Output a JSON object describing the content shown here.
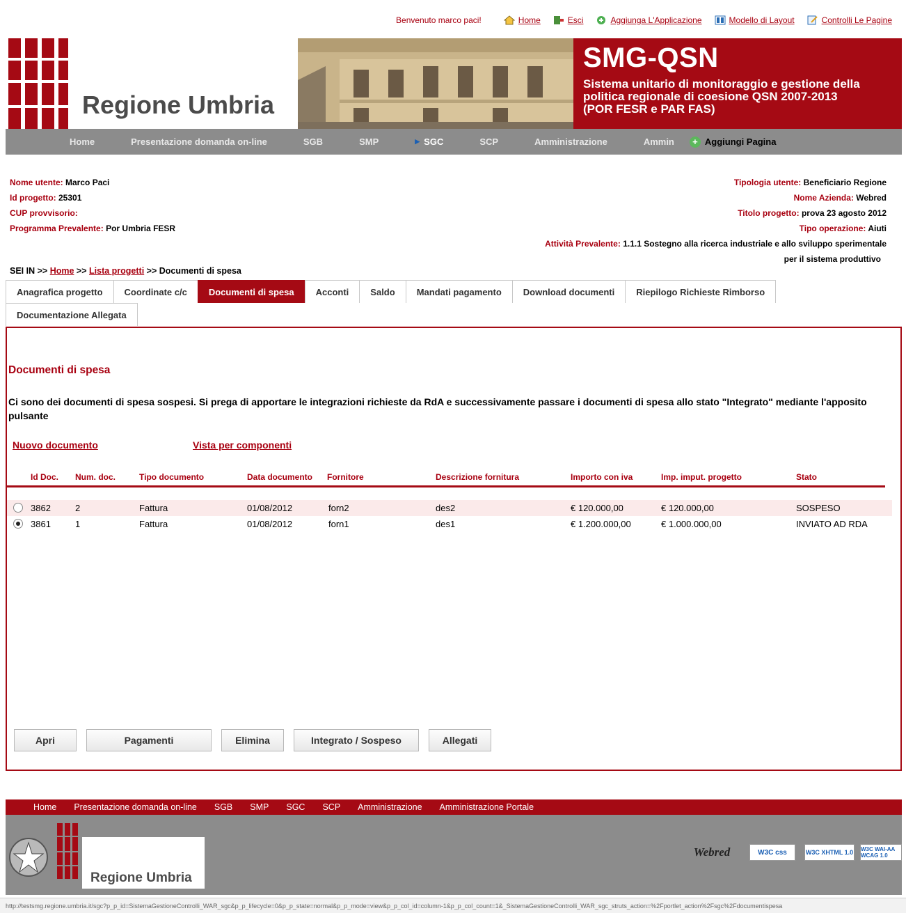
{
  "header": {
    "welcome": "Benvenuto marco paci!",
    "links": [
      {
        "label": "Home",
        "icon": "home-icon"
      },
      {
        "label": "Esci",
        "icon": "exit-icon"
      },
      {
        "label": "Aggiunga L'Applicazione",
        "icon": "add-icon"
      },
      {
        "label": "Modello di Layout",
        "icon": "layout-icon"
      },
      {
        "label": "Controlli Le Pagine",
        "icon": "edit-page-icon"
      }
    ]
  },
  "banner": {
    "region": "Regione Umbria",
    "title": "SMG-QSN",
    "subtitle_line1": "Sistema unitario di monitoraggio e gestione della",
    "subtitle_line2": "politica regionale di coesione QSN 2007-2013",
    "subtitle_line3": "(POR FESR e PAR FAS)",
    "brand_red": "#a50a14"
  },
  "nav": {
    "items": [
      "Home",
      "Presentazione domanda on-line",
      "SGB",
      "SMP",
      "SGC",
      "SCP",
      "Amministrazione",
      "Ammin"
    ],
    "active": "SGC",
    "add_page": "Aggiungi Pagina"
  },
  "info": {
    "left": [
      {
        "label": "Nome utente:",
        "value": "Marco Paci"
      },
      {
        "label": "Id progetto:",
        "value": "25301"
      },
      {
        "label": "CUP provvisorio:",
        "value": ""
      },
      {
        "label": "Programma Prevalente:",
        "value": "Por Umbria FESR"
      }
    ],
    "right": [
      {
        "label": "Tipologia utente:",
        "value": "Beneficiario  Regione"
      },
      {
        "label": "Nome Azienda:",
        "value": "Webred"
      },
      {
        "label": "Titolo progetto:",
        "value": "prova 23 agosto 2012"
      },
      {
        "label": "Tipo operazione:",
        "value": " Aiuti"
      },
      {
        "label": "Attività Prevalente:",
        "value": "1.1.1 Sostegno alla ricerca industriale e allo sviluppo sperimentale"
      }
    ],
    "right_continuation": "per il sistema produttivo"
  },
  "breadcrumb": {
    "prefix": "SEI IN",
    "sep": ">>",
    "home": "Home",
    "list": "Lista progetti",
    "current": "Documenti di spesa"
  },
  "tabs": {
    "row1": [
      "Anagrafica progetto",
      "Coordinate c/c",
      "Documenti di spesa",
      "Acconti",
      "Saldo",
      "Mandati pagamento",
      "Download documenti",
      "Riepilogo Richieste Rimborso"
    ],
    "row2": [
      "Documentazione Allegata"
    ],
    "active": "Documenti di spesa"
  },
  "main": {
    "title": "Documenti di spesa",
    "message": "Ci sono dei documenti di spesa sospesi. Si prega di apportare le integrazioni richieste da RdA e successivamente passare i documenti di spesa allo stato \"Integrato\" mediante l'apposito pulsante",
    "new_doc": "Nuovo documento",
    "by_component": "Vista per componenti"
  },
  "table": {
    "headers": [
      "Id Doc.",
      "Num. doc.",
      "Tipo documento",
      "Data documento",
      "Fornitore",
      "Descrizione fornitura",
      "Importo con iva",
      "Imp. imput. progetto",
      "Stato"
    ],
    "rows": [
      {
        "selected": false,
        "cells": [
          "3862",
          "2",
          "Fattura",
          "01/08/2012",
          "forn2",
          "des2",
          "€ 120.000,00",
          "€ 120.000,00",
          "SOSPESO"
        ]
      },
      {
        "selected": true,
        "cells": [
          "3861",
          "1",
          "Fattura",
          "01/08/2012",
          "forn1",
          "des1",
          "€ 1.200.000,00",
          "€ 1.000.000,00",
          "INVIATO AD RDA"
        ]
      }
    ]
  },
  "buttons": [
    "Apri",
    "Pagamenti",
    "Elimina",
    "Integrato / Sospeso",
    "Allegati"
  ],
  "footer": {
    "nav": [
      "Home",
      "Presentazione domanda on-line",
      "SGB",
      "SMP",
      "SGC",
      "SCP",
      "Amministrazione",
      "Amministrazione Portale"
    ],
    "region": "Regione Umbria",
    "badges": [
      "Webred",
      "W3C css",
      "W3C XHTML 1.0",
      "W3C WAI-AA WCAG 1.0"
    ]
  },
  "status_url": "http://testsmg.regione.umbria.it/sgc?p_p_id=SistemaGestioneControlli_WAR_sgc&p_p_lifecycle=0&p_p_state=normal&p_p_mode=view&p_p_col_id=column-1&p_p_col_count=1&_SistemaGestioneControlli_WAR_sgc_struts_action=%2Fportlet_action%2Fsgc%2Fdocumentispesa"
}
